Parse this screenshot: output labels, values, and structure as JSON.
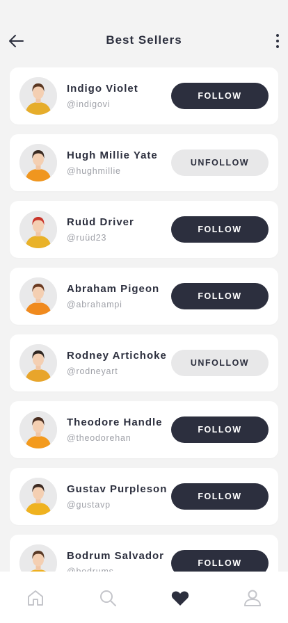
{
  "header": {
    "title": "Best Sellers",
    "back_icon": "arrow-left-icon",
    "more_icon": "more-vertical-icon"
  },
  "users": [
    {
      "name": "Indigo Violet",
      "handle": "@indigovi",
      "action": "FOLLOW",
      "state": "follow",
      "shirt": "#e6ad2b",
      "hair": "#5a3722"
    },
    {
      "name": "Hugh Millie Yate",
      "handle": "@hughmillie",
      "action": "UNFOLLOW",
      "state": "unfollow",
      "shirt": "#f0961f",
      "hair": "#3a2a22"
    },
    {
      "name": "Ruüd Driver",
      "handle": "@ruüd23",
      "action": "FOLLOW",
      "state": "follow",
      "shirt": "#e9b229",
      "hair": "#c9352a"
    },
    {
      "name": "Abraham Pigeon",
      "handle": "@abrahampi",
      "action": "FOLLOW",
      "state": "follow",
      "shirt": "#f08a1e",
      "hair": "#6b3b22"
    },
    {
      "name": "Rodney Artichoke",
      "handle": "@rodneyart",
      "action": "UNFOLLOW",
      "state": "unfollow",
      "shirt": "#e8a52b",
      "hair": "#2f2621"
    },
    {
      "name": "Theodore Handle",
      "handle": "@theodorehan",
      "action": "FOLLOW",
      "state": "follow",
      "shirt": "#f39a1d",
      "hair": "#4a2e20"
    },
    {
      "name": "Gustav Purpleson",
      "handle": "@gustavp",
      "action": "FOLLOW",
      "state": "follow",
      "shirt": "#efb21f",
      "hair": "#3c2a22"
    },
    {
      "name": "Bodrum Salvador",
      "handle": "@bodrums",
      "action": "FOLLOW",
      "state": "follow",
      "shirt": "#eeb020",
      "hair": "#5a3a26"
    }
  ],
  "tabs": [
    {
      "icon": "home-icon",
      "active": false
    },
    {
      "icon": "search-icon",
      "active": false
    },
    {
      "icon": "heart-icon",
      "active": true
    },
    {
      "icon": "user-icon",
      "active": false
    }
  ],
  "colors": {
    "primary": "#2c2f3e",
    "secondary_button": "#e8e8e9",
    "background": "#f3f3f3",
    "muted_text": "#9fa1a8",
    "inactive_icon": "#c4c5ca"
  }
}
